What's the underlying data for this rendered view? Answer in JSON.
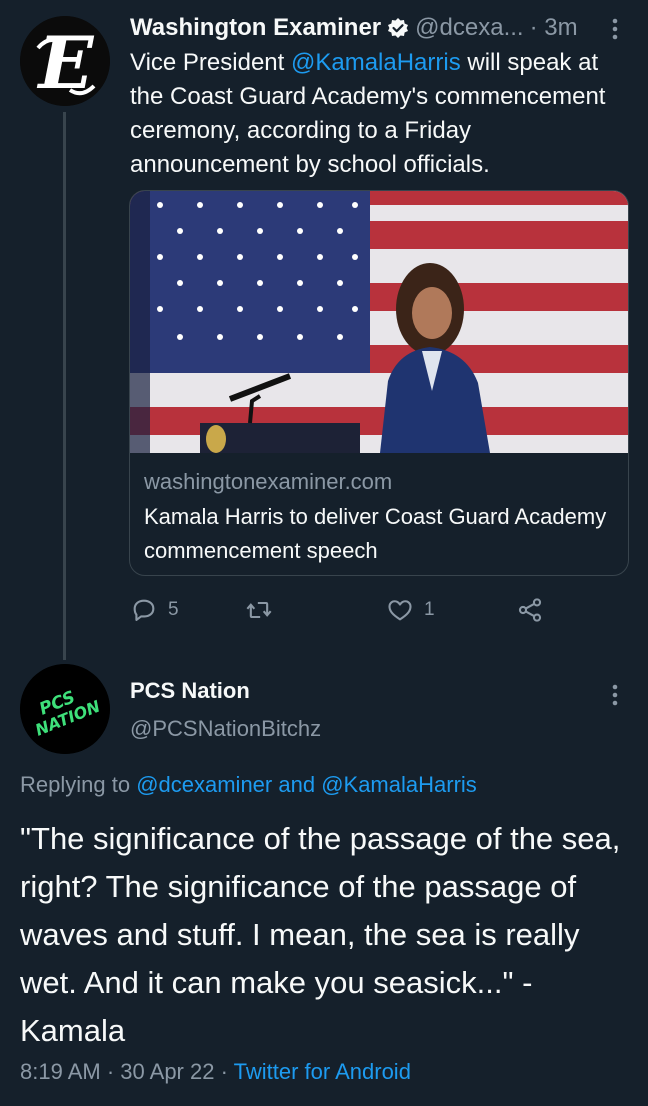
{
  "tweet1": {
    "author_name": "Washington Examiner",
    "handle": "@dcexa...",
    "time": "· 3m",
    "avatar_letter": "E",
    "text_before_mention": "Vice President ",
    "mention": "@KamalaHarris",
    "text_after_mention": " will speak at the Coast Guard Academy's commencement ceremony, according to a Friday announcement by school officials.",
    "card": {
      "domain": "washingtonexaminer.com",
      "title": "Kamala Harris to deliver Coast Guard Academy commencement speech"
    },
    "actions": {
      "reply_count": "5",
      "like_count": "1"
    }
  },
  "tweet2": {
    "author_name": "PCS Nation",
    "handle": "@PCSNationBitchz",
    "avatar_text_1": "PCS",
    "avatar_text_2": "NATION",
    "replying_prefix": "Replying to ",
    "replying_to_1": "@dcexaminer",
    "replying_and": " and ",
    "replying_to_2": "@KamalaHarris",
    "text": "\"The significance of the passage of the sea, right? The significance of the passage of waves and stuff. I mean, the sea is really wet. And it can make you seasick...\" - Kamala",
    "time": "8:19 AM",
    "date": "30 Apr 22",
    "source": "Twitter for Android"
  },
  "colors": {
    "background": "#15202b",
    "accent": "#1d9bf0",
    "secondary_text": "#8b98a5",
    "border": "#38444d",
    "avatar2_text": "#3ee07a"
  },
  "icons": [
    "verified-badge-icon",
    "more-icon",
    "reply-icon",
    "retweet-icon",
    "like-icon",
    "share-icon"
  ]
}
